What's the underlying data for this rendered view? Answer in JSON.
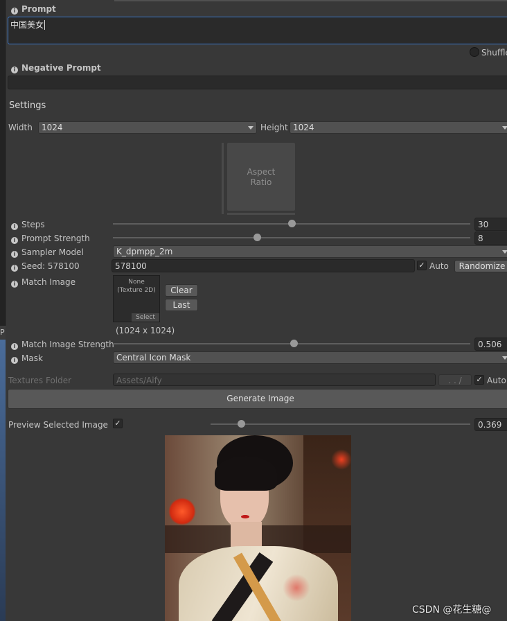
{
  "prompt": {
    "label": "Prompt",
    "value": "中国美女",
    "shuffle_label": "Shuffle"
  },
  "negative_prompt": {
    "label": "Negative Prompt",
    "value": ""
  },
  "settings": {
    "title": "Settings",
    "width_label": "Width",
    "width_value": "1024",
    "height_label": "Height",
    "height_value": "1024",
    "aspect_ratio_label": "Aspect Ratio",
    "steps": {
      "label": "Steps",
      "value": "30",
      "fraction": 0.5
    },
    "prompt_strength": {
      "label": "Prompt Strength",
      "value": "8",
      "fraction": 0.403
    },
    "sampler": {
      "label": "Sampler Model",
      "value": "K_dpmpp_2m"
    },
    "seed": {
      "label": "Seed: 578100",
      "value": "578100",
      "auto_label": "Auto",
      "auto_checked": true,
      "randomize_label": "Randomize"
    },
    "match_image": {
      "label": "Match Image",
      "none_text": "None",
      "type_text": "(Texture 2D)",
      "select_label": "Select",
      "clear_label": "Clear",
      "last_label": "Last",
      "size_text": "(1024 x 1024)"
    },
    "match_strength": {
      "label": "Match Image Strength",
      "value": "0.506",
      "fraction": 0.506
    },
    "mask": {
      "label": "Mask",
      "value": "Central Icon Mask"
    },
    "textures_folder": {
      "label": "Textures Folder",
      "value": "Assets/Aify",
      "browse_label": ". . /",
      "auto_label": "Auto",
      "auto_checked": true
    },
    "generate_label": "Generate Image",
    "preview": {
      "label": "Preview Selected Image",
      "checked": true,
      "value": "0.369",
      "fraction": 0.117
    }
  },
  "left_panel_letter": "P",
  "watermark": "CSDN @花生糖@"
}
